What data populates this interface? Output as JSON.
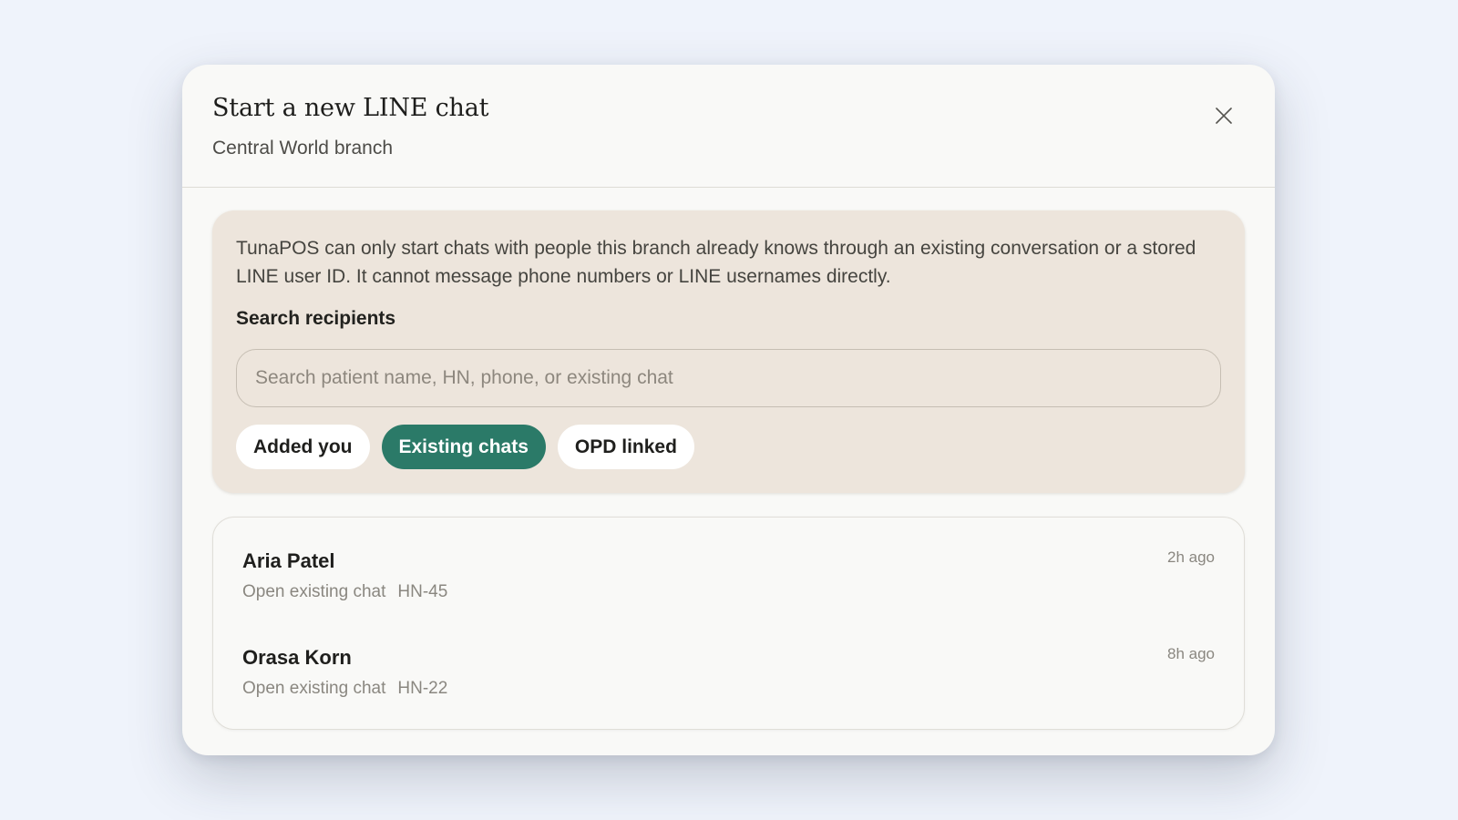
{
  "dialog": {
    "title": "Start a new LINE chat",
    "subtitle": "Central World branch",
    "close_icon": "close-icon"
  },
  "info": {
    "text": "TunaPOS can only start chats with people this branch already knows through an existing conversation or a stored LINE user ID. It cannot message phone numbers or LINE usernames directly.",
    "search_label": "Search recipients",
    "search_placeholder": "Search patient name, HN, phone, or existing chat",
    "search_value": ""
  },
  "filters": [
    {
      "label": "Added you",
      "active": false
    },
    {
      "label": "Existing chats",
      "active": true
    },
    {
      "label": "OPD linked",
      "active": false
    }
  ],
  "recipients": [
    {
      "name": "Aria Patel",
      "action": "Open existing chat",
      "hn": "HN-45",
      "time": "2h ago"
    },
    {
      "name": "Orasa Korn",
      "action": "Open existing chat",
      "hn": "HN-22",
      "time": "8h ago"
    }
  ],
  "colors": {
    "page_background": "#eff3fb",
    "dialog_background": "#f9f9f7",
    "info_panel": "#ede5dc",
    "accent": "#2b7a68"
  }
}
